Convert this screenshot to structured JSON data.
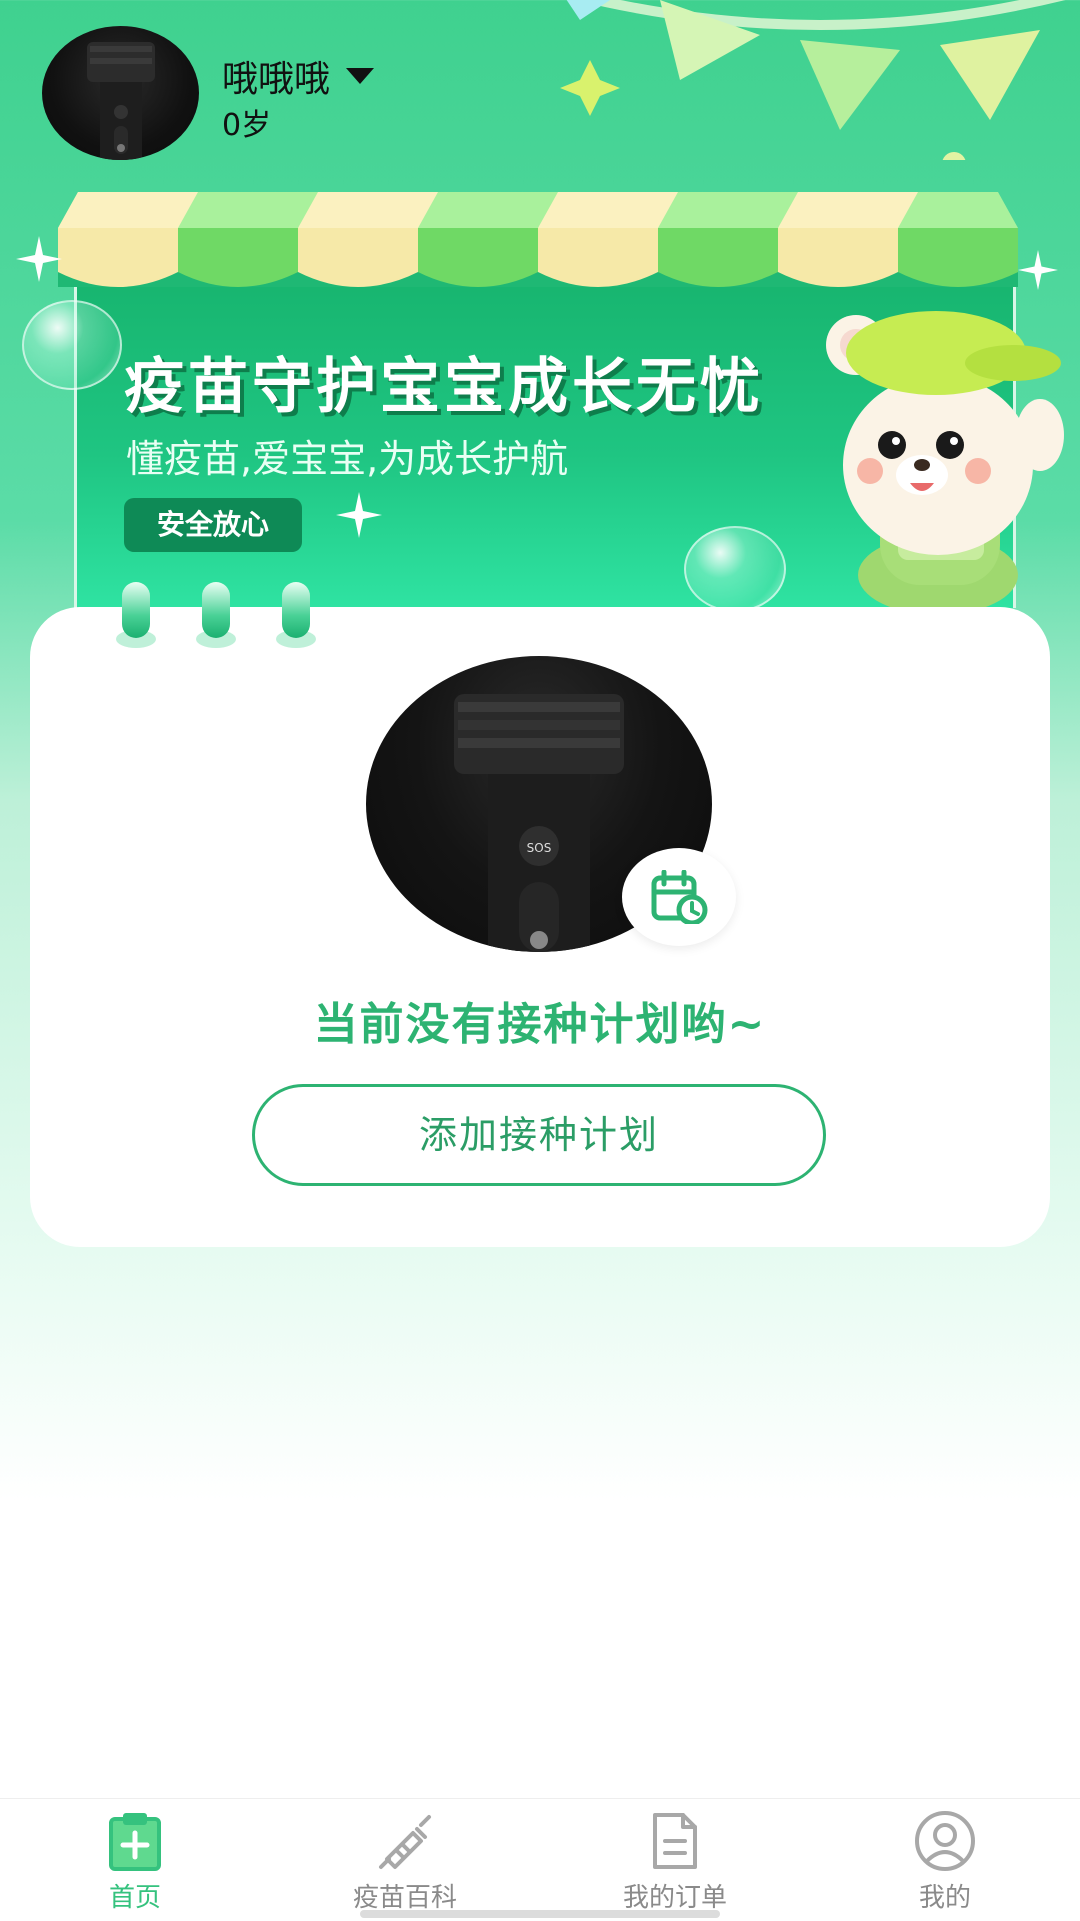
{
  "header": {
    "user_name": "哦哦哦",
    "user_age": "0岁",
    "dropdown_icon": "caret-down-icon"
  },
  "banner": {
    "title": "疫苗守护宝宝成长无忧",
    "subtitle": "懂疫苗,爱宝宝,为成长护航",
    "badge": "安全放心"
  },
  "card": {
    "empty_message": "当前没有接种计划哟~",
    "add_plan_label": "添加接种计划",
    "calendar_icon": "calendar-clock-icon"
  },
  "tabbar": {
    "active_index": 0,
    "active_color": "#35c27e",
    "inactive_color": "#8a8a8a",
    "items": [
      {
        "label": "首页",
        "icon": "clipboard-plus-icon"
      },
      {
        "label": "疫苗百科",
        "icon": "syringe-icon"
      },
      {
        "label": "我的订单",
        "icon": "document-icon"
      },
      {
        "label": "我的",
        "icon": "user-circle-icon"
      }
    ]
  },
  "colors": {
    "brand_green": "#2db372",
    "banner_green": "#17b46e"
  }
}
